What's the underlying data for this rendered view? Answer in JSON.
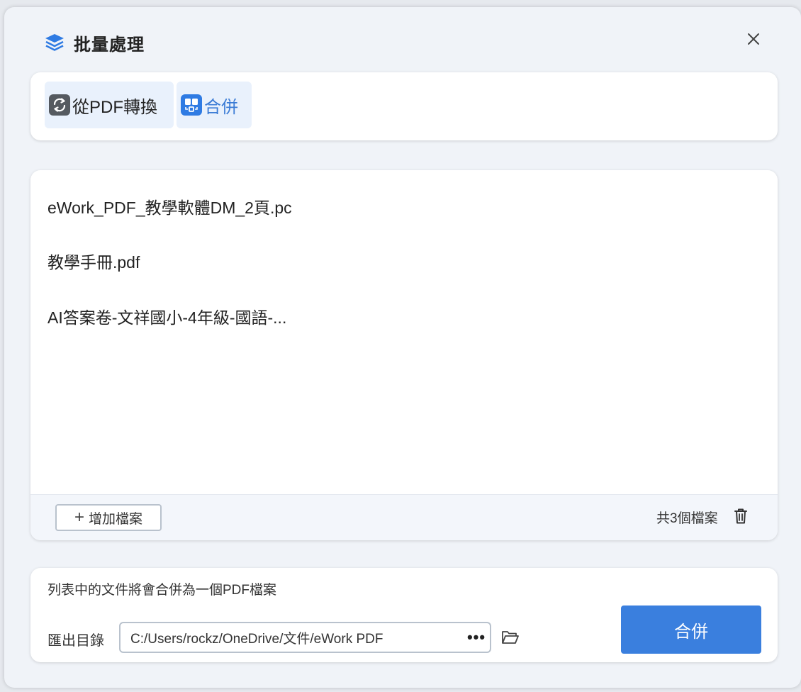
{
  "dialog": {
    "title": "批量處理",
    "title_icon": "layers-icon",
    "close_icon": "close-icon"
  },
  "tabs": [
    {
      "label": "從PDF轉換",
      "icon": "convert-icon",
      "active": false
    },
    {
      "label": "合併",
      "icon": "merge-icon",
      "active": true
    }
  ],
  "file_list": {
    "items": [
      {
        "name": "eWork_PDF_教學軟體DM_2頁.pc"
      },
      {
        "name": "教學手冊.pdf"
      },
      {
        "name": "AI答案卷-文祥國小-4年級-國語-..."
      }
    ],
    "add_label": "增加檔案",
    "count_label": "共3個檔案",
    "trash_icon": "trash-icon"
  },
  "output": {
    "info": "列表中的文件將會合併為一個PDF檔案",
    "export_label": "匯出目錄",
    "path_value": "C:/Users/rockz/OneDrive/文件/eWork PDF",
    "dots_label": "•••",
    "folder_icon": "folder-open-icon",
    "merge_label": "合併"
  },
  "colors": {
    "accent": "#3a7fde",
    "tab_active_bg": "#e9f1fc",
    "background": "#f0f3f8"
  }
}
